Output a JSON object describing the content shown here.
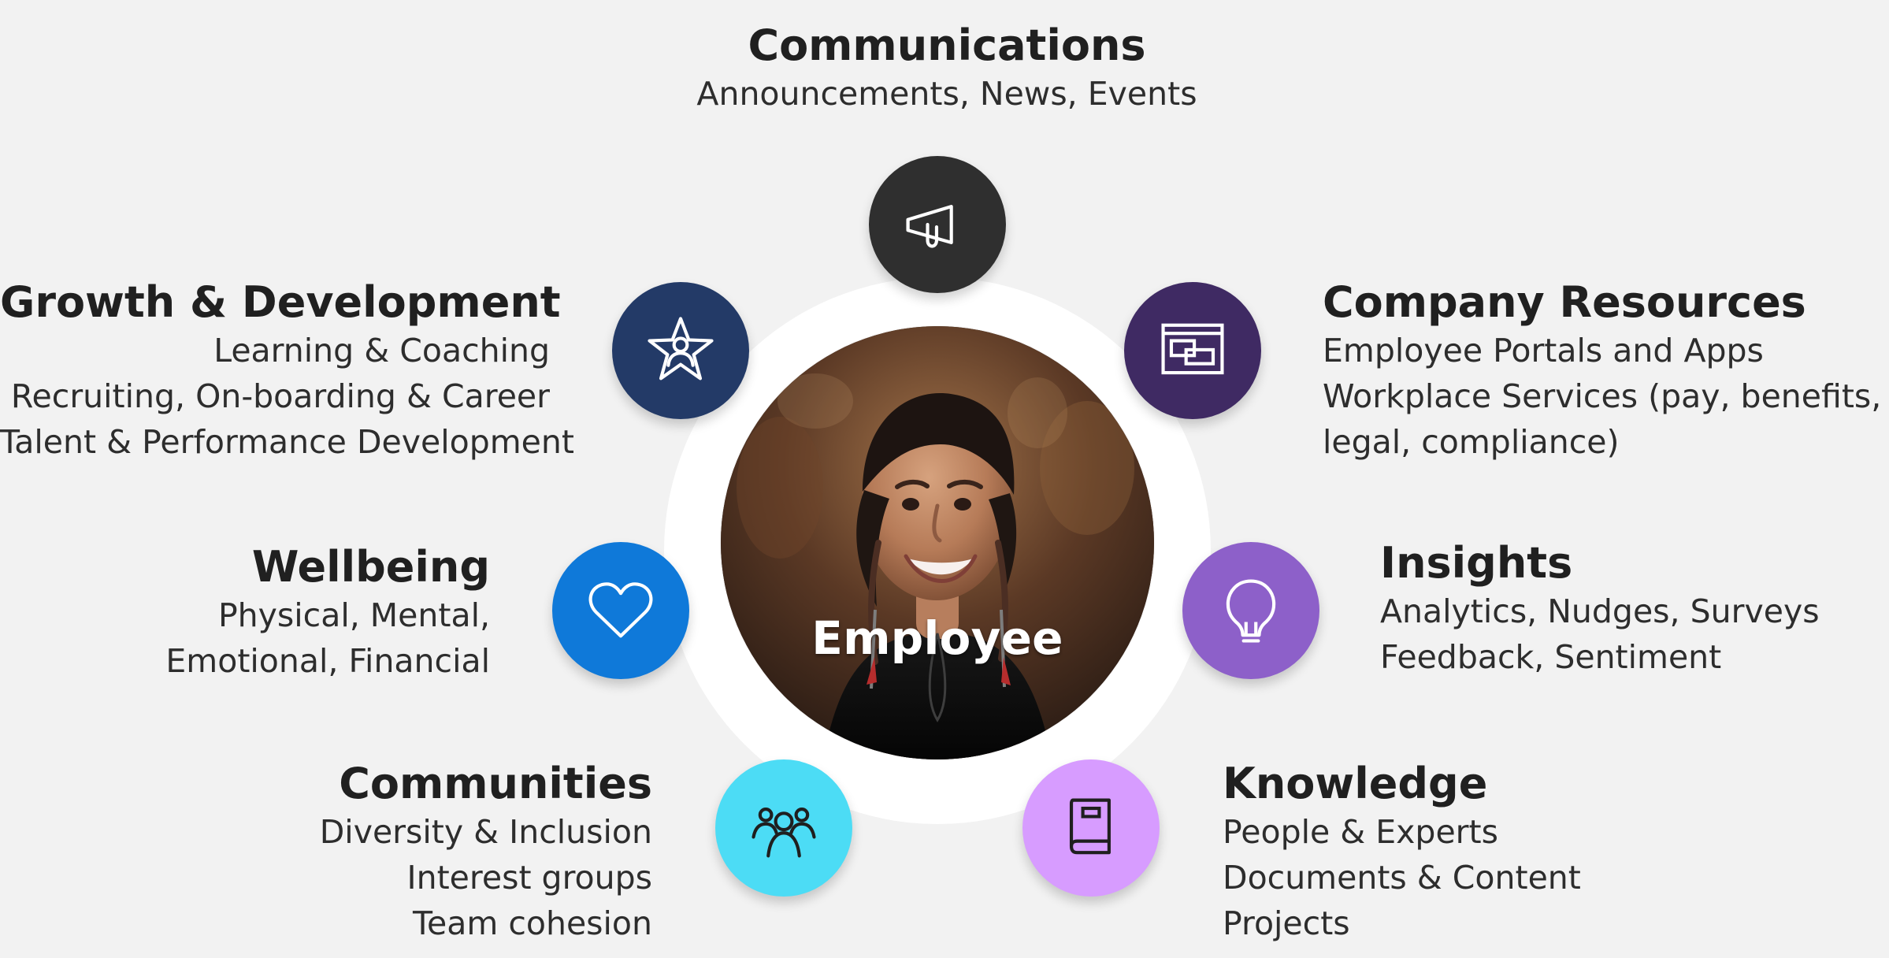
{
  "center": {
    "label": "Employee"
  },
  "communications": {
    "title": "Communications",
    "items": [
      "Announcements, News, Events"
    ],
    "icon": "megaphone-icon",
    "color": "#2f2f2f"
  },
  "growth": {
    "title": "Growth & Development",
    "items": [
      "Learning & Coaching",
      "Recruiting, On-boarding & Career",
      "Talent & Performance Development"
    ],
    "icon": "star-person-icon",
    "color": "#233a67"
  },
  "resources": {
    "title": "Company Resources",
    "items": [
      "Employee Portals and Apps",
      "Workplace Services (pay, benefits, IT,",
      "legal, compliance)"
    ],
    "icon": "browser-window-icon",
    "color": "#3f2a63"
  },
  "wellbeing": {
    "title": "Wellbeing",
    "items": [
      "Physical, Mental,",
      "Emotional, Financial"
    ],
    "icon": "heart-icon",
    "color": "#0f79d9"
  },
  "insights": {
    "title": "Insights",
    "items": [
      "Analytics, Nudges, Surveys",
      "Feedback, Sentiment"
    ],
    "icon": "lightbulb-icon",
    "color": "#8d60c9"
  },
  "communities": {
    "title": "Communities",
    "items": [
      "Diversity & Inclusion",
      "Interest groups",
      "Team cohesion"
    ],
    "icon": "people-group-icon",
    "color": "#4cdcf5"
  },
  "knowledge": {
    "title": "Knowledge",
    "items": [
      "People & Experts",
      "Documents & Content",
      "Projects"
    ],
    "icon": "book-icon",
    "color": "#d79cff"
  }
}
